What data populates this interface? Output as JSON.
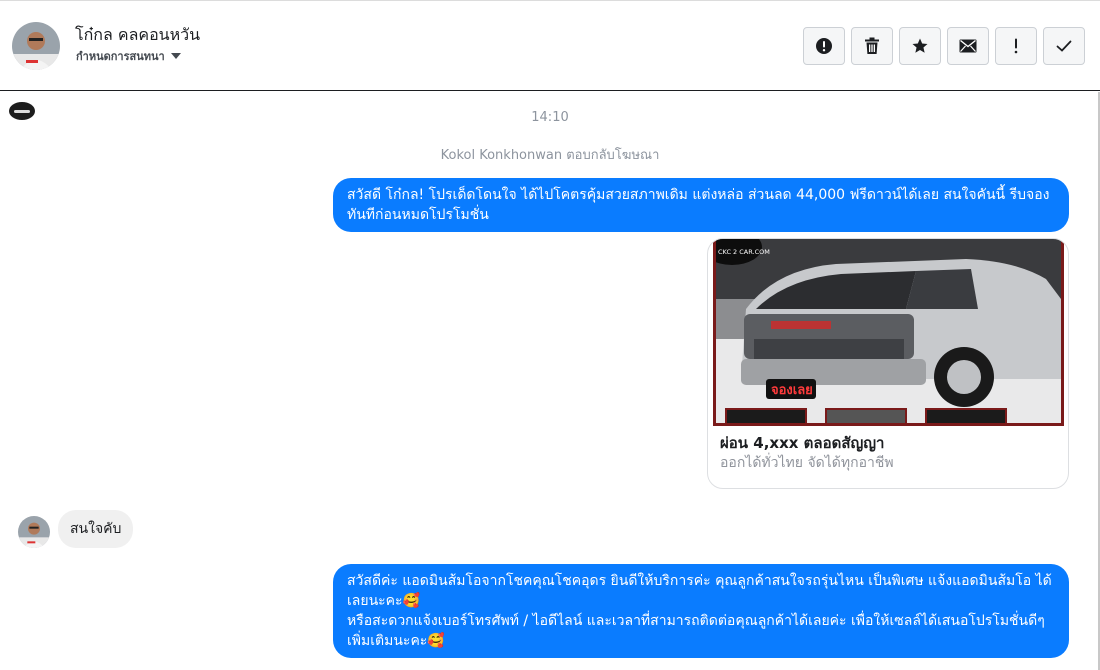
{
  "header": {
    "contact_name": "โก๋กล คลคอนหวัน",
    "subtitle": "กำหนดการสนทนา",
    "actions": [
      {
        "icon": "alert-circle-icon",
        "label": "spam"
      },
      {
        "icon": "trash-icon",
        "label": "delete"
      },
      {
        "icon": "star-icon",
        "label": "star"
      },
      {
        "icon": "mail-icon",
        "label": "mark-unread"
      },
      {
        "icon": "exclamation-icon",
        "label": "important"
      },
      {
        "icon": "check-icon",
        "label": "done"
      }
    ]
  },
  "thread": {
    "timestamp": "14:10",
    "replied_note": "Kokol Konkhonwan ตอบกลับโฆษณา",
    "messages": [
      {
        "direction": "out",
        "text": "สวัสดี โก๋กล! โปรเด็ดโดนใจ ได้ไปโคตรคุ้มสวยสภาพเดิม แต่งหล่อ  ส่วนลด 44,000 ฟรีดาวน์ได้เลย  สนใจคันนี้ รีบจองทันทีก่อนหมดโปรโมชั่น"
      },
      {
        "direction": "out",
        "type": "card",
        "image": "CKC 2 CAR.COM",
        "badge": "จองเลย",
        "title": "ผ่อน 4,xxx ตลอดสัญญา",
        "subtitle": "ออกได้ทั่วไทย จัดได้ทุกอาชีพ"
      },
      {
        "direction": "in",
        "text": "สนใจคับ"
      },
      {
        "direction": "out",
        "lines": [
          "สวัสดีค่ะ แอดมินส้มโอจากโชคคุณโชคอุดร ยินดีให้บริการค่ะ   คุณลูกค้าสนใจรถรุ่นไหน เป็นพิเศษ แจ้งแอดมินส้มโอ ได้เลยนะคะ🥰",
          "หรือสะดวกแจ้งเบอร์โทรศัพท์ / ไอดีไลน์ และเวลาที่สามารถติดต่อคุณลูกค้าได้เลยค่ะ เพื่อให้เซลล์ได้เสนอโปรโมชั่นดีๆเพิ่มเติมนะคะ🥰"
        ]
      }
    ]
  },
  "colors": {
    "accent": "#0a7cff",
    "incoming_bubble": "#f0f0f0",
    "muted_text": "#8d949e"
  }
}
